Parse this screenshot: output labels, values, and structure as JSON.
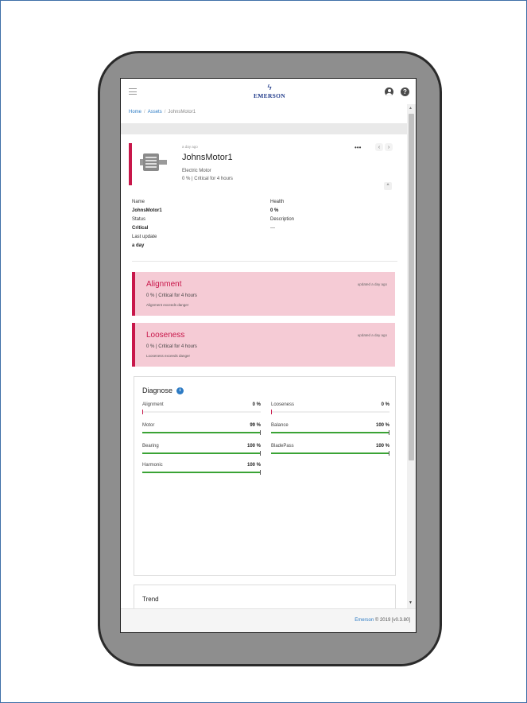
{
  "header": {
    "brand": "EMERSON",
    "user_icon": "user-circle-icon",
    "help_icon": "question-circle-icon",
    "help_glyph": "?"
  },
  "breadcrumb": {
    "home": "Home",
    "assets": "Assets",
    "current": "JohnsMotor1",
    "separator": "/"
  },
  "asset": {
    "time": "a day ago",
    "name": "JohnsMotor1",
    "type": "Electric Motor",
    "status_line": "0 % | Critical for 4 hours",
    "menu_glyph": "•••",
    "prev_glyph": "‹",
    "next_glyph": "›",
    "collapse_glyph": "^"
  },
  "info": {
    "name_label": "Name",
    "name_value": "JohnsMotor1",
    "status_label": "Status",
    "status_value": "Critical",
    "update_label": "Last update",
    "update_value": "a day",
    "health_label": "Health",
    "health_value": "0 %",
    "desc_label": "Description",
    "desc_value": "---"
  },
  "alerts": [
    {
      "title": "Alignment",
      "updated": "updated a day ago",
      "line1": "0 % | Critical for 4 hours",
      "line2": "Alignment exceeds danger"
    },
    {
      "title": "Looseness",
      "updated": "updated a day ago",
      "line1": "0 % | Critical for 4 hours",
      "line2": "Looseness exceeds danger"
    }
  ],
  "diagnose": {
    "title": "Diagnose",
    "info_glyph": "i",
    "metrics": [
      {
        "label": "Alignment",
        "value": "0 %",
        "percent": 0,
        "color": "#c8174a"
      },
      {
        "label": "Looseness",
        "value": "0 %",
        "percent": 0,
        "color": "#c8174a"
      },
      {
        "label": "Motor",
        "value": "99 %",
        "percent": 99,
        "color": "#3aa335"
      },
      {
        "label": "Balance",
        "value": "100 %",
        "percent": 100,
        "color": "#3aa335"
      },
      {
        "label": "Bearing",
        "value": "100 %",
        "percent": 100,
        "color": "#3aa335"
      },
      {
        "label": "BladePass",
        "value": "100 %",
        "percent": 100,
        "color": "#3aa335"
      },
      {
        "label": "Harmonic",
        "value": "100 %",
        "percent": 100,
        "color": "#3aa335"
      }
    ]
  },
  "trend": {
    "title": "Trend"
  },
  "footer": {
    "brand_link": "Emerson",
    "copyright": " © 2019 [v0.3.80]"
  },
  "colors": {
    "accent": "#c8174a",
    "alert_bg": "#f5cbd5",
    "ok": "#3aa335",
    "link": "#2d7bc4",
    "brand": "#1f3a8a"
  }
}
